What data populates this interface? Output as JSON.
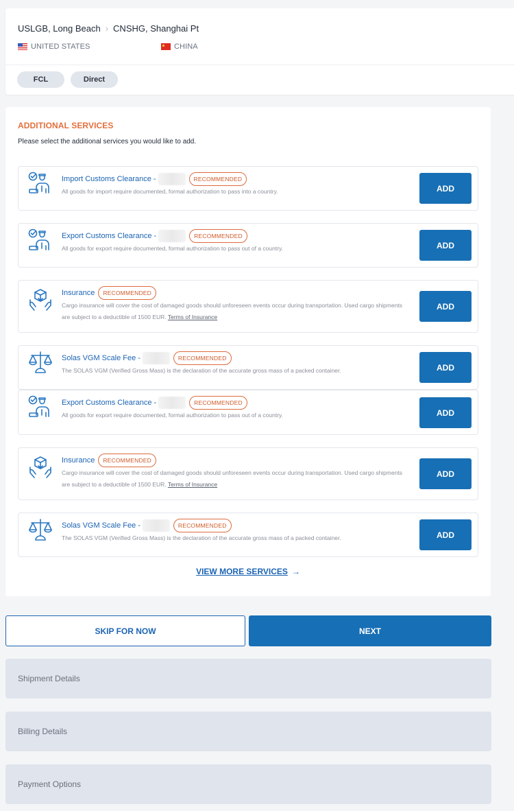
{
  "route": {
    "origin": "USLGB, Long Beach",
    "separator_icon": "chevron-right-icon",
    "destination": "CNSHG, Shanghai Pt",
    "origin_country": "UNITED STATES",
    "origin_flag": "us-flag-icon",
    "destination_country": "CHINA",
    "destination_flag": "cn-flag-icon",
    "tags": [
      "FCL",
      "Direct"
    ]
  },
  "services": {
    "title": "ADDITIONAL SERVICES",
    "subtitle": "Please select the additional services you would like to add.",
    "badge_label": "RECOMMENDED",
    "add_label": "ADD",
    "items": [
      {
        "icon": "customs-officer-icon",
        "name": "Import Customs Clearance",
        "has_price": true,
        "description": "All goods for import require documented, formal authorization to pass into a country.",
        "link": ""
      },
      {
        "icon": "customs-officer-icon",
        "name": "Export Customs Clearance",
        "has_price": true,
        "description": "All goods for export require documented, formal authorization to pass out of a country.",
        "link": ""
      },
      {
        "icon": "insurance-hands-box-icon",
        "name": "Insurance",
        "has_price": false,
        "description": "Cargo insurance will cover the cost of damaged goods should unforeseen events occur during transportation. Used cargo shipments are subject to a deductible of 1500 EUR.",
        "link": "Terms of Insurance"
      },
      {
        "icon": "scale-icon",
        "name": "Solas VGM Scale Fee",
        "has_price": true,
        "description": "The SOLAS VGM (Verified Gross Mass) is the declaration of the accurate gross mass of a packed container.",
        "link": ""
      },
      {
        "icon": "customs-officer-icon",
        "name": "Export Customs Clearance",
        "has_price": true,
        "description": "All goods for export require documented, formal authorization to pass out of a country.",
        "link": ""
      },
      {
        "icon": "insurance-hands-box-icon",
        "name": "Insurance",
        "has_price": false,
        "description": "Cargo insurance will cover the cost of damaged goods should unforeseen events occur during transportation. Used cargo shipments are subject to a deductible of 1500 EUR.",
        "link": "Terms of Insurance"
      },
      {
        "icon": "scale-icon",
        "name": "Solas VGM Scale Fee",
        "has_price": true,
        "description": "The SOLAS VGM (Verified Gross Mass) is the declaration of the accurate gross mass of a packed container.",
        "link": ""
      }
    ],
    "view_more_label": "VIEW MORE SERVICES",
    "view_more_icon": "arrow-right-icon"
  },
  "actions": {
    "skip_label": "SKIP FOR NOW",
    "next_label": "NEXT"
  },
  "accordions": [
    "Shipment Details",
    "Billing Details",
    "Payment Options"
  ],
  "colors": {
    "primary": "#176fb5",
    "accent_orange": "#e36f3c",
    "link_blue": "#1c64b3",
    "accordion_bg": "#e0e4ec",
    "page_bg": "#f4f5f7"
  }
}
